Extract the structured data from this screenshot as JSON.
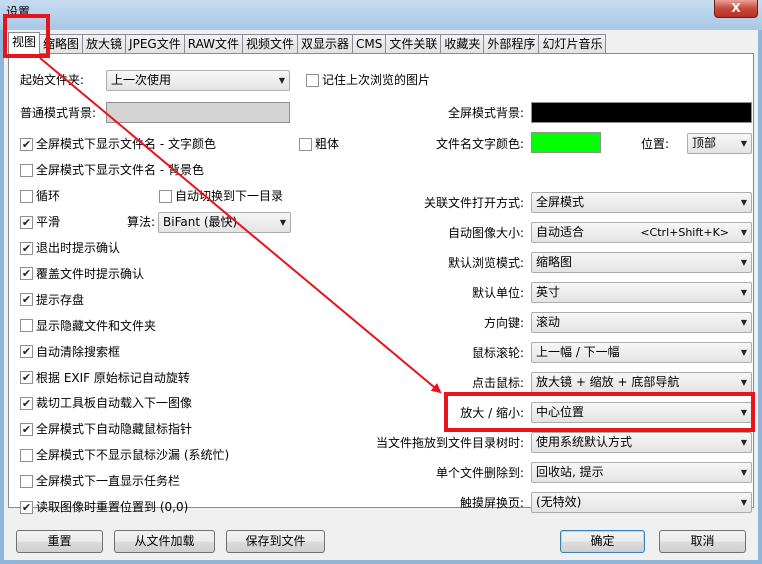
{
  "window": {
    "title": "设置",
    "close_label": "X"
  },
  "tabs": [
    "视图",
    "缩略图",
    "放大镜",
    "JPEG文件",
    "RAW文件",
    "视频文件",
    "双显示器",
    "CMS",
    "文件关联",
    "收藏夹",
    "外部程序",
    "幻灯片音乐"
  ],
  "left": {
    "start_folder_label": "起始文件夹:",
    "start_folder_value": "上一次使用",
    "remember_last": {
      "label": "记住上次浏览的图片",
      "checked": false
    },
    "normal_bg_label": "普通模式背景:",
    "normal_bg_color": "#d4d4d4",
    "fs_filename_text": {
      "label": "全屏模式下显示文件名 - 文字颜色",
      "checked": true
    },
    "bold": {
      "label": "粗体",
      "checked": false
    },
    "fs_filename_bg": {
      "label": "全屏模式下显示文件名 - 背景色",
      "checked": false
    },
    "loop": {
      "label": "循环",
      "checked": false
    },
    "auto_next": {
      "label": "自动切换到下一目录",
      "checked": false
    },
    "smooth": {
      "label": "平滑",
      "checked": true
    },
    "algorithm_label": "算法:",
    "algorithm_value": "BiFant (最快)",
    "options": [
      {
        "label": "退出时提示确认",
        "checked": true
      },
      {
        "label": "覆盖文件时提示确认",
        "checked": true
      },
      {
        "label": "提示存盘",
        "checked": true
      },
      {
        "label": "显示隐藏文件和文件夹",
        "checked": false
      },
      {
        "label": "自动清除搜索框",
        "checked": true
      },
      {
        "label": "根据 EXIF 原始标记自动旋转",
        "checked": true
      },
      {
        "label": "裁切工具板自动载入下一图像",
        "checked": true
      },
      {
        "label": "全屏模式下自动隐藏鼠标指针",
        "checked": true
      },
      {
        "label": "全屏模式下不显示鼠标沙漏 (系统忙)",
        "checked": false
      },
      {
        "label": "全屏模式下一直显示任务栏",
        "checked": false
      },
      {
        "label": "读取图像时重置位置到 (0,0)",
        "checked": true
      }
    ]
  },
  "right": {
    "fs_bg_label": "全屏模式背景:",
    "fs_bg_color": "#000000",
    "filename_color_label": "文件名文字颜色:",
    "filename_color": "#00ff00",
    "position_label": "位置:",
    "position_value": "顶部",
    "settings": [
      {
        "label": "关联文件打开方式:",
        "value": "全屏模式",
        "hint": ""
      },
      {
        "label": "自动图像大小:",
        "value": "自动适合",
        "hint": "<Ctrl+Shift+K>"
      },
      {
        "label": "默认浏览模式:",
        "value": "缩略图",
        "hint": ""
      },
      {
        "label": "默认单位:",
        "value": "英寸",
        "hint": ""
      },
      {
        "label": "方向键:",
        "value": "滚动",
        "hint": ""
      },
      {
        "label": "鼠标滚轮:",
        "value": "上一幅 / 下一幅",
        "hint": ""
      },
      {
        "label": "点击鼠标:",
        "value": "放大镜 + 缩放 + 底部导航",
        "hint": ""
      },
      {
        "label": "放大 / 缩小:",
        "value": "中心位置",
        "hint": ""
      },
      {
        "label": "当文件拖放到文件目录树时:",
        "value": "使用系统默认方式",
        "hint": ""
      },
      {
        "label": "单个文件删除到:",
        "value": "回收站, 提示",
        "hint": ""
      },
      {
        "label": "触摸屏换页:",
        "value": "(无特效)",
        "hint": ""
      }
    ]
  },
  "buttons": {
    "reset": "重置",
    "load": "从文件加载",
    "save": "保存到文件",
    "ok": "确定",
    "cancel": "取消"
  },
  "annotation": {
    "color": "#e8141c"
  }
}
